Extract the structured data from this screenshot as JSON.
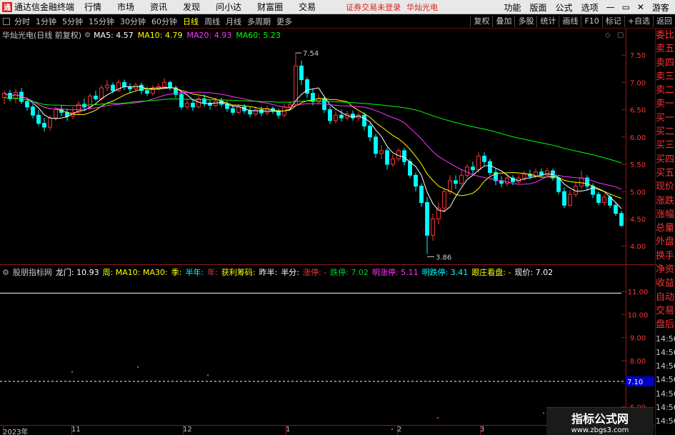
{
  "menubar": {
    "logo_text": "通",
    "title": "通达信金融终端",
    "items": [
      "行情",
      "市场",
      "资讯",
      "发现",
      "问小达",
      "财富圈",
      "交易"
    ],
    "status": "证券交易未登录",
    "stock": "华灿光电",
    "right_items": [
      "功能",
      "版面",
      "公式",
      "选项"
    ],
    "user": "游客",
    "win_min": "—",
    "win_max": "▭",
    "win_close": "✕"
  },
  "toolbar": {
    "periods": [
      "分时",
      "1分钟",
      "5分钟",
      "15分钟",
      "30分钟",
      "60分钟",
      "日线",
      "周线",
      "月线",
      "多周期",
      "更多"
    ],
    "active_period": "日线",
    "right_buttons": [
      "复权",
      "叠加",
      "多股",
      "统计",
      "画线",
      "F10",
      "标记",
      "+自选",
      "返回"
    ]
  },
  "stock_info": {
    "name": "华灿光电(日线 前复权)",
    "ma": [
      {
        "label": "MA5: 4.57",
        "color": "#ffffff"
      },
      {
        "label": "MA10: 4.79",
        "color": "#ffff00"
      },
      {
        "label": "MA20: 4.93",
        "color": "#ff33ff"
      },
      {
        "label": "MA60: 5.23",
        "color": "#00ff00"
      }
    ],
    "high_label": "7.54",
    "low_label": "3.86"
  },
  "chart_data": {
    "type": "candlestick",
    "price_axis": [
      "7.50",
      "7.00",
      "6.50",
      "6.00",
      "5.50",
      "5.00",
      "4.50",
      "4.00"
    ],
    "ylim": [
      3.8,
      7.75
    ],
    "sub_axis": [
      "11.00",
      "10.00",
      "9.00",
      "8.00",
      "7.00",
      "6.00"
    ],
    "sub_ylim": [
      5.3,
      11.5
    ],
    "sub_marker": "7.10",
    "dates": [
      "2023年",
      "11",
      "12",
      "1",
      "2",
      "3"
    ],
    "candles": [
      [
        6.72,
        6.8,
        6.85,
        6.6
      ],
      [
        6.8,
        6.7,
        6.86,
        6.65
      ],
      [
        6.7,
        6.82,
        6.88,
        6.62
      ],
      [
        6.82,
        6.65,
        6.9,
        6.6
      ],
      [
        6.65,
        6.55,
        6.72,
        6.48
      ],
      [
        6.55,
        6.4,
        6.6,
        6.34
      ],
      [
        6.4,
        6.25,
        6.5,
        6.2
      ],
      [
        6.25,
        6.18,
        6.35,
        6.1
      ],
      [
        6.18,
        6.35,
        6.4,
        6.12
      ],
      [
        6.35,
        6.5,
        6.55,
        6.3
      ],
      [
        6.5,
        6.45,
        6.58,
        6.38
      ],
      [
        6.45,
        6.38,
        6.52,
        6.3
      ],
      [
        6.38,
        6.45,
        6.55,
        6.33
      ],
      [
        6.45,
        6.6,
        6.66,
        6.4
      ],
      [
        6.6,
        6.55,
        6.7,
        6.5
      ],
      [
        6.55,
        6.75,
        6.8,
        6.5
      ],
      [
        6.75,
        6.7,
        6.85,
        6.66
      ],
      [
        6.7,
        6.9,
        6.95,
        6.66
      ],
      [
        6.9,
        6.95,
        7.05,
        6.84
      ],
      [
        6.95,
        6.85,
        7.0,
        6.8
      ],
      [
        6.85,
        7.0,
        7.05,
        6.82
      ],
      [
        7.0,
        6.92,
        7.05,
        6.86
      ],
      [
        6.92,
        6.88,
        6.98,
        6.8
      ],
      [
        6.88,
        6.95,
        7.0,
        6.82
      ],
      [
        6.95,
        6.85,
        7.0,
        6.78
      ],
      [
        6.85,
        6.8,
        6.92,
        6.75
      ],
      [
        6.8,
        6.88,
        6.95,
        6.76
      ],
      [
        6.88,
        6.92,
        6.98,
        6.84
      ],
      [
        6.92,
        7.0,
        7.08,
        6.88
      ],
      [
        7.0,
        6.9,
        7.03,
        6.85
      ],
      [
        6.9,
        6.78,
        6.94,
        6.72
      ],
      [
        6.78,
        6.55,
        6.82,
        6.5
      ],
      [
        6.55,
        6.62,
        6.7,
        6.5
      ],
      [
        6.62,
        6.55,
        6.7,
        6.48
      ],
      [
        6.55,
        6.7,
        6.75,
        6.52
      ],
      [
        6.7,
        6.62,
        6.78,
        6.55
      ],
      [
        6.62,
        6.58,
        6.68,
        6.5
      ],
      [
        6.58,
        6.66,
        6.72,
        6.54
      ],
      [
        6.66,
        6.6,
        6.72,
        6.55
      ],
      [
        6.6,
        6.52,
        6.66,
        6.46
      ],
      [
        6.52,
        6.45,
        6.58,
        6.4
      ],
      [
        6.45,
        6.55,
        6.6,
        6.42
      ],
      [
        6.55,
        6.48,
        6.6,
        6.42
      ],
      [
        6.48,
        6.42,
        6.55,
        6.36
      ],
      [
        6.42,
        6.5,
        6.56,
        6.38
      ],
      [
        6.5,
        6.44,
        6.56,
        6.38
      ],
      [
        6.44,
        6.52,
        6.58,
        6.4
      ],
      [
        6.52,
        6.48,
        6.56,
        6.42
      ],
      [
        6.48,
        6.4,
        6.52,
        6.34
      ],
      [
        6.4,
        6.55,
        6.6,
        6.36
      ],
      [
        6.55,
        6.6,
        6.66,
        6.5
      ],
      [
        6.6,
        7.3,
        7.54,
        6.58
      ],
      [
        7.3,
        7.05,
        7.4,
        6.95
      ],
      [
        7.05,
        6.8,
        7.1,
        6.72
      ],
      [
        6.8,
        6.65,
        6.88,
        6.58
      ],
      [
        6.65,
        6.7,
        6.78,
        6.6
      ],
      [
        6.7,
        6.5,
        6.75,
        6.44
      ],
      [
        6.5,
        6.3,
        6.56,
        6.24
      ],
      [
        6.3,
        6.4,
        6.46,
        6.25
      ],
      [
        6.4,
        6.35,
        6.5,
        6.28
      ],
      [
        6.35,
        6.42,
        6.48,
        6.3
      ],
      [
        6.42,
        6.35,
        6.48,
        6.3
      ],
      [
        6.35,
        6.4,
        6.45,
        6.3
      ],
      [
        6.4,
        6.2,
        6.45,
        6.12
      ],
      [
        6.2,
        6.0,
        6.25,
        5.92
      ],
      [
        6.0,
        5.7,
        6.05,
        5.62
      ],
      [
        5.7,
        5.75,
        5.85,
        5.6
      ],
      [
        5.75,
        5.5,
        5.8,
        5.4
      ],
      [
        5.5,
        5.6,
        5.68,
        5.45
      ],
      [
        5.6,
        5.75,
        5.8,
        5.55
      ],
      [
        5.75,
        5.55,
        5.8,
        5.48
      ],
      [
        5.55,
        5.3,
        5.6,
        5.25
      ],
      [
        5.3,
        5.1,
        5.35,
        5.0
      ],
      [
        5.1,
        4.8,
        5.15,
        4.72
      ],
      [
        4.8,
        4.2,
        4.9,
        3.86
      ],
      [
        4.2,
        4.5,
        4.6,
        4.1
      ],
      [
        4.5,
        4.7,
        4.8,
        4.4
      ],
      [
        4.7,
        5.0,
        5.05,
        4.62
      ],
      [
        5.0,
        5.2,
        5.3,
        4.95
      ],
      [
        5.2,
        5.15,
        5.3,
        5.05
      ],
      [
        5.15,
        5.3,
        5.4,
        5.1
      ],
      [
        5.3,
        5.45,
        5.5,
        5.25
      ],
      [
        5.45,
        5.4,
        5.55,
        5.3
      ],
      [
        5.4,
        5.65,
        5.72,
        5.35
      ],
      [
        5.65,
        5.55,
        5.72,
        5.48
      ],
      [
        5.55,
        5.35,
        5.6,
        5.3
      ],
      [
        5.35,
        5.2,
        5.42,
        5.12
      ],
      [
        5.2,
        5.15,
        5.28,
        5.08
      ],
      [
        5.15,
        5.25,
        5.32,
        5.1
      ],
      [
        5.25,
        5.18,
        5.3,
        5.12
      ],
      [
        5.18,
        5.25,
        5.32,
        5.14
      ],
      [
        5.25,
        5.32,
        5.38,
        5.2
      ],
      [
        5.32,
        5.28,
        5.4,
        5.22
      ],
      [
        5.28,
        5.36,
        5.42,
        5.24
      ],
      [
        5.36,
        5.3,
        5.42,
        5.26
      ],
      [
        5.3,
        5.38,
        5.44,
        5.28
      ],
      [
        5.38,
        5.25,
        5.42,
        5.2
      ],
      [
        5.25,
        5.0,
        5.3,
        4.95
      ],
      [
        5.0,
        4.75,
        5.08,
        4.7
      ],
      [
        4.75,
        4.95,
        5.02,
        4.72
      ],
      [
        4.95,
        5.1,
        5.18,
        4.9
      ],
      [
        5.1,
        5.25,
        5.38,
        5.05
      ],
      [
        5.25,
        5.1,
        5.3,
        5.02
      ],
      [
        5.1,
        4.95,
        5.15,
        4.88
      ],
      [
        4.95,
        4.8,
        5.0,
        4.75
      ],
      [
        4.8,
        4.9,
        4.96,
        4.74
      ],
      [
        4.9,
        4.75,
        4.95,
        4.7
      ],
      [
        4.75,
        4.6,
        4.8,
        4.55
      ],
      [
        4.6,
        4.38,
        4.65,
        4.35
      ]
    ],
    "ma5": [
      6.72,
      6.74,
      6.76,
      6.75,
      6.7,
      6.62,
      6.52,
      6.42,
      6.35,
      6.34,
      6.38,
      6.42,
      6.46,
      6.5,
      6.54,
      6.6,
      6.65,
      6.72,
      6.8,
      6.84,
      6.88,
      6.9,
      6.91,
      6.92,
      6.9,
      6.88,
      6.86,
      6.86,
      6.88,
      6.89,
      6.86,
      6.79,
      6.7,
      6.62,
      6.61,
      6.61,
      6.62,
      6.63,
      6.63,
      6.6,
      6.57,
      6.54,
      6.5,
      6.48,
      6.47,
      6.47,
      6.48,
      6.47,
      6.46,
      6.47,
      6.52,
      6.67,
      6.85,
      7.0,
      7.05,
      6.95,
      6.78,
      6.6,
      6.48,
      6.4,
      6.38,
      6.38,
      6.37,
      6.32,
      6.22,
      6.07,
      5.9,
      5.75,
      5.65,
      5.6,
      5.55,
      5.48,
      5.35,
      5.1,
      4.85,
      4.7,
      4.64,
      4.67,
      4.8,
      5.05,
      5.25,
      5.32,
      5.4,
      5.48,
      5.5,
      5.45,
      5.38,
      5.3,
      5.25,
      5.22,
      5.24,
      5.25,
      5.28,
      5.3,
      5.32,
      5.3,
      5.24,
      5.14,
      5.03,
      4.98,
      4.98,
      5.02,
      5.03,
      5.0,
      4.95,
      4.88,
      4.8,
      4.7
    ]
  },
  "sub_indicator": {
    "name": "股朋指标网",
    "items": [
      {
        "label": "龙门: 10.93",
        "color": "#ffffff"
      },
      {
        "label": "周: MA10: MA30:",
        "color": "#ffff00"
      },
      {
        "label": "季:",
        "color": "#ffff00"
      },
      {
        "label": "半年:",
        "color": "#00ffff"
      },
      {
        "label": "年:",
        "color": "#ff3333"
      },
      {
        "label": "获利筹码:",
        "color": "#ffff00"
      },
      {
        "label": "昨半:",
        "color": "#ffffff"
      },
      {
        "label": "半分:",
        "color": "#ffffff"
      },
      {
        "label": "涨停: -",
        "color": "#ff3333"
      },
      {
        "label": "跌停: 7.02",
        "color": "#00cc33"
      },
      {
        "label": "明涨停: 5.11",
        "color": "#ff33ff"
      },
      {
        "label": "明跌停: 3.41",
        "color": "#00ffff"
      },
      {
        "label": "跟庄看盘: -",
        "color": "#ffff00"
      },
      {
        "label": "现价: 7.02",
        "color": "#ffffff"
      }
    ]
  },
  "side_panel": {
    "items": [
      {
        "label": "委比",
        "cls": "red"
      },
      {
        "label": "卖五",
        "cls": "red"
      },
      {
        "label": "卖四",
        "cls": "red"
      },
      {
        "label": "卖三",
        "cls": "red"
      },
      {
        "label": "卖二",
        "cls": "red"
      },
      {
        "label": "卖一",
        "cls": "red"
      },
      {
        "label": "买一",
        "cls": "red"
      },
      {
        "label": "买二",
        "cls": "red"
      },
      {
        "label": "买三",
        "cls": "red"
      },
      {
        "label": "买四",
        "cls": "red"
      },
      {
        "label": "买五",
        "cls": "red"
      },
      {
        "label": "现价",
        "cls": "red"
      },
      {
        "label": "涨跌",
        "cls": "red"
      },
      {
        "label": "涨幅",
        "cls": "red"
      },
      {
        "label": "总量",
        "cls": "red"
      },
      {
        "label": "外盘",
        "cls": "red"
      },
      {
        "label": "换手",
        "cls": "red"
      },
      {
        "label": "净资",
        "cls": "red"
      },
      {
        "label": "收益",
        "cls": "red"
      },
      {
        "label": "自动",
        "cls": "red"
      },
      {
        "label": "交易",
        "cls": "red"
      },
      {
        "label": "盘后",
        "cls": "red"
      },
      {
        "label": "14:56",
        "cls": "time"
      },
      {
        "label": "14:56",
        "cls": "time"
      },
      {
        "label": "14:56",
        "cls": "time"
      },
      {
        "label": "14:56",
        "cls": "time"
      },
      {
        "label": "14:56",
        "cls": "time"
      },
      {
        "label": "14:56",
        "cls": "time"
      },
      {
        "label": "14:56",
        "cls": "time"
      }
    ]
  },
  "watermark": {
    "title": "指标公式网",
    "url": "www.zbgs3.com"
  }
}
